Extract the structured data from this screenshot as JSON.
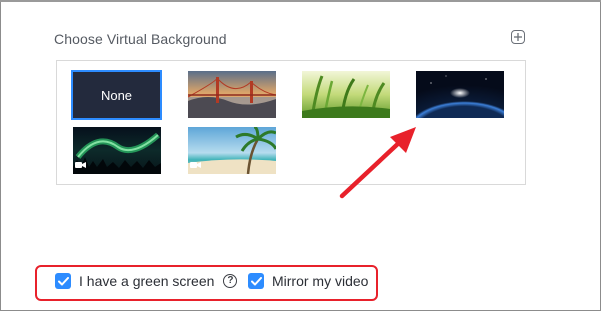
{
  "virtual_background": {
    "heading": "Choose Virtual Background",
    "add_icon": "plus-square-icon",
    "thumbnails": [
      {
        "id": "none",
        "label": "None",
        "selected": true
      },
      {
        "id": "golden-gate-bridge",
        "label": "",
        "selected": false,
        "video": false
      },
      {
        "id": "grass",
        "label": "",
        "selected": false,
        "video": false
      },
      {
        "id": "earth-from-space",
        "label": "",
        "selected": false,
        "video": false
      },
      {
        "id": "aurora",
        "label": "",
        "selected": false,
        "video": true
      },
      {
        "id": "beach",
        "label": "",
        "selected": false,
        "video": true
      }
    ]
  },
  "options": {
    "green_screen": {
      "label": "I have a green screen",
      "checked": true,
      "help_icon": "question-circle-icon"
    },
    "mirror_video": {
      "label": "Mirror my video",
      "checked": true
    }
  },
  "annotations": {
    "arrow_color": "#e8212b",
    "highlight_color": "#e8212b"
  },
  "colors": {
    "accent": "#2d8cff",
    "none_tile_bg": "#232a3d"
  }
}
